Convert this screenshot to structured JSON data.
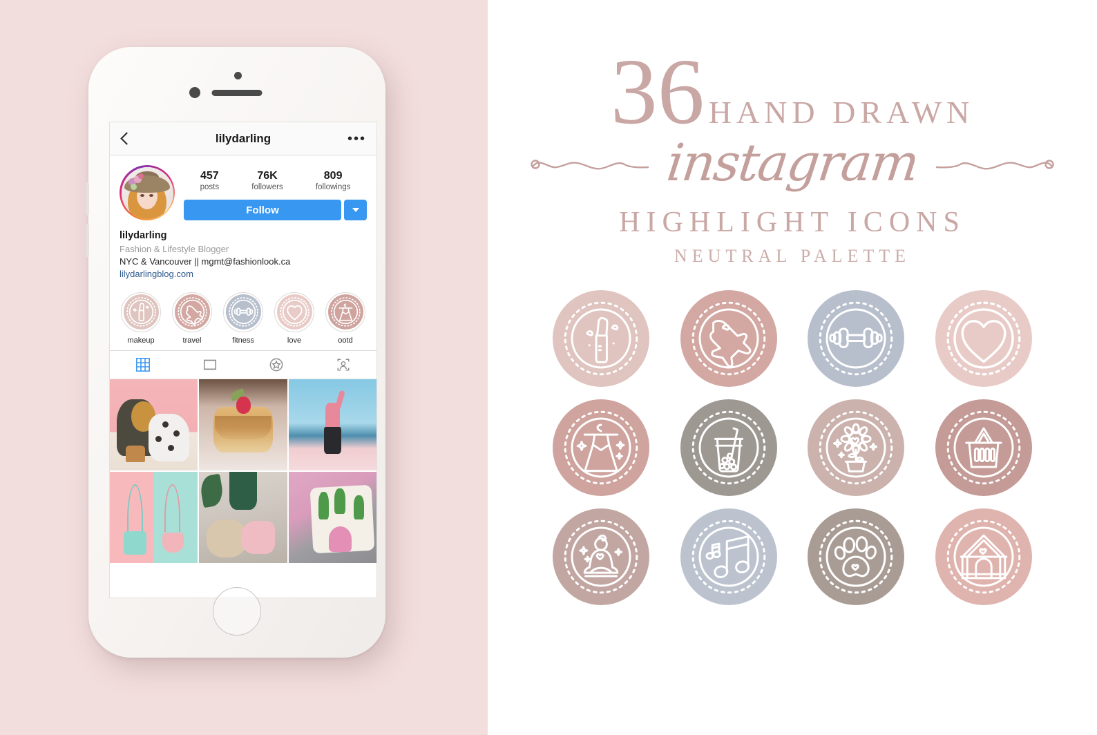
{
  "background": {
    "left_panel_color": "#f2dedd",
    "right_panel_color": "#ffffff"
  },
  "phone": {
    "device": "white-smartphone",
    "speaker": "earpiece-speaker",
    "camera": "front-camera",
    "sensor": "proximity-sensor",
    "home_button": "home-button"
  },
  "instagram": {
    "navbar": {
      "back": "back-chevron",
      "title": "lilydarling",
      "more": "•••"
    },
    "avatar": "illustrated-girl-with-floral-hat",
    "stats": [
      {
        "num": "457",
        "lbl": "posts"
      },
      {
        "num": "76K",
        "lbl": "followers"
      },
      {
        "num": "809",
        "lbl": "followings"
      }
    ],
    "follow_label": "Follow",
    "follow_color": "#3897f0",
    "bio": {
      "name": "lilydarling",
      "subtitle": "Fashion & Lifestyle Blogger",
      "line": "NYC & Vancouver || mgmt@fashionlook.ca",
      "link": "lilydarlingblog.com",
      "link_color": "#2d5a8c"
    },
    "highlights": [
      {
        "label": "makeup",
        "icon": "lipstick-icon",
        "color": "#dfc4bf"
      },
      {
        "label": "travel",
        "icon": "airplane-icon",
        "color": "#d3a8a2"
      },
      {
        "label": "fitness",
        "icon": "dumbbell-icon",
        "color": "#b8bfcc"
      },
      {
        "label": "love",
        "icon": "heart-icon",
        "color": "#e8cbc7"
      },
      {
        "label": "ootd",
        "icon": "dress-icon",
        "color": "#cfa39e"
      }
    ],
    "tabs": [
      {
        "name": "grid-tab",
        "icon": "grid-icon",
        "active": true
      },
      {
        "name": "list-tab",
        "icon": "list-icon",
        "active": false
      },
      {
        "name": "saved-tab",
        "icon": "star-circle-icon",
        "active": false
      },
      {
        "name": "tagged-tab",
        "icon": "tagged-person-icon",
        "active": false
      }
    ],
    "tab_active_color": "#3897f0",
    "photos": [
      "girl-hugging-dalmatian-on-pink",
      "pancake-stack-with-berries",
      "woman-stretching-on-pink-beach",
      "two-pastel-crossbody-bags",
      "flatlay-knit-bag-and-pink-shoes",
      "cactus-print-pillows"
    ]
  },
  "promo": {
    "number": "36",
    "hand_drawn": "HAND DRAWN",
    "script": "instagram",
    "highlight_icons": "HIGHLIGHT ICONS",
    "neutral_palette": "NEUTRAL PALETTE",
    "text_color": "#c9a7a4"
  },
  "icon_grid": [
    {
      "name": "lipstick-icon",
      "color": "#dfc4bf"
    },
    {
      "name": "airplane-icon",
      "color": "#d3a8a2"
    },
    {
      "name": "dumbbell-icon",
      "color": "#b8bfcc"
    },
    {
      "name": "heart-icon",
      "color": "#e8cbc7"
    },
    {
      "name": "dress-icon",
      "color": "#cfa39e"
    },
    {
      "name": "bubble-tea-icon",
      "color": "#9e9893"
    },
    {
      "name": "potted-flower-icon",
      "color": "#cbb2ad"
    },
    {
      "name": "shopping-basket-icon",
      "color": "#c49b96"
    },
    {
      "name": "yoga-meditation-icon",
      "color": "#c2a6a2"
    },
    {
      "name": "music-note-icon",
      "color": "#bcc3cf"
    },
    {
      "name": "paw-print-icon",
      "color": "#a89c94"
    },
    {
      "name": "dog-house-icon",
      "color": "#e0b4ae"
    }
  ]
}
